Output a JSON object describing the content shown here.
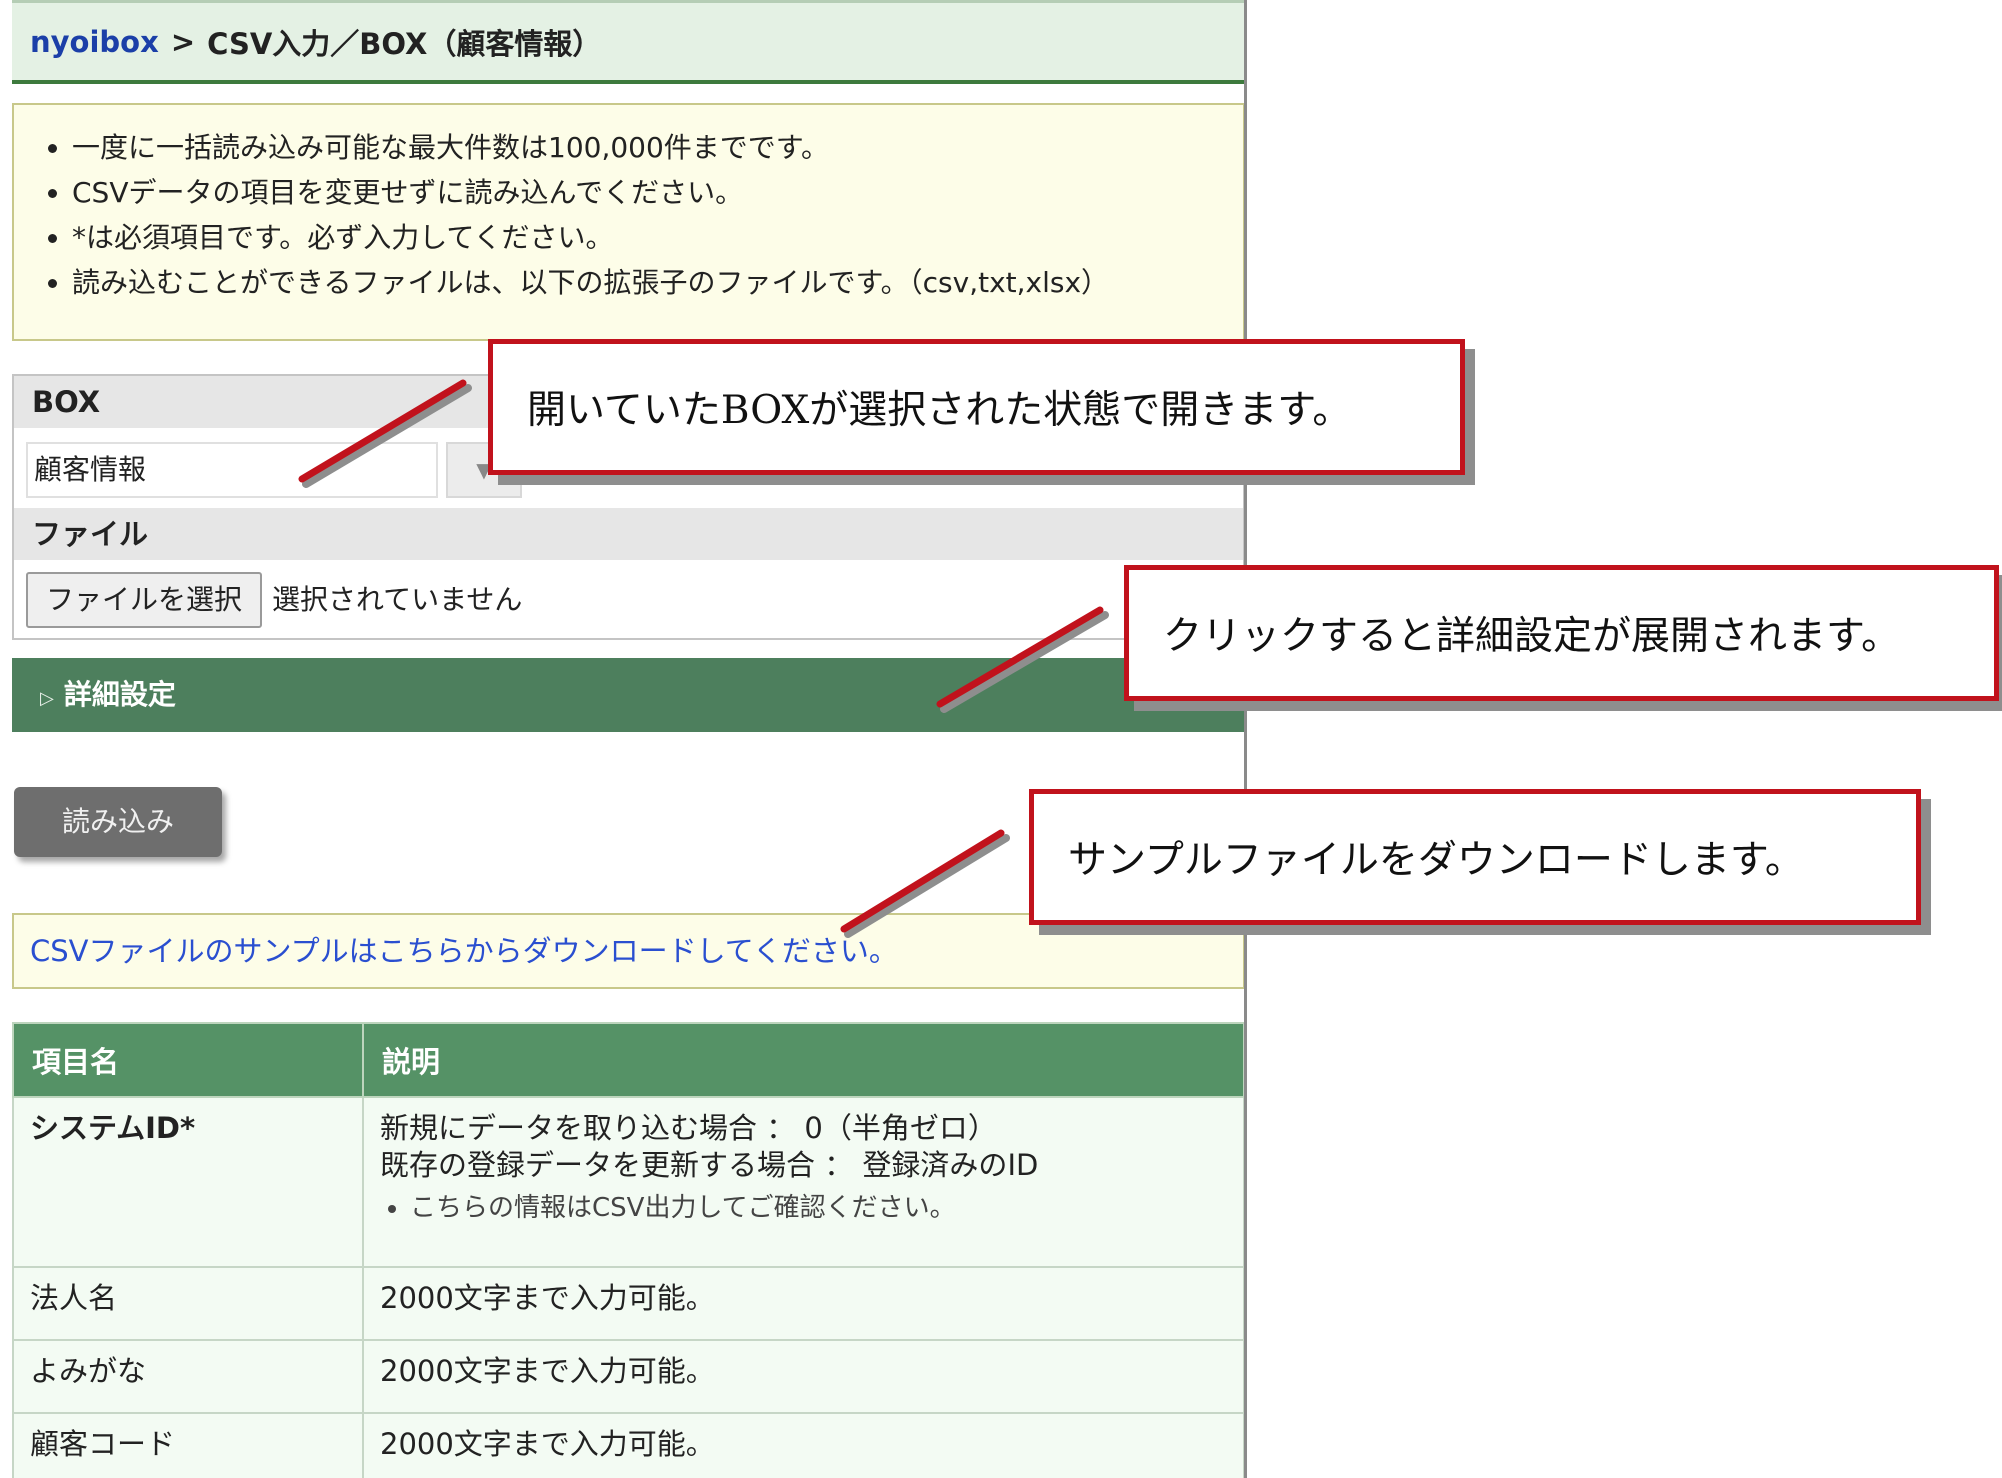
{
  "breadcrumb": {
    "root": "nyoibox",
    "separator": ">",
    "current": "CSV入力／BOX（顧客情報）"
  },
  "notice": {
    "items": [
      "一度に一括読み込み可能な最大件数は100,000件までです。",
      "CSVデータの項目を変更せずに読み込んでください。",
      "*は必須項目です。必ず入力してください。",
      "読み込むことができるファイルは、以下の拡張子のファイルです。（csv,txt,xlsx）"
    ]
  },
  "form": {
    "box_label": "BOX",
    "box_value": "顧客情報",
    "file_label": "ファイル",
    "file_button": "ファイルを選択",
    "file_status": "選択されていません"
  },
  "advanced": {
    "label": "詳細設定"
  },
  "load_button": "読み込み",
  "sample_link": "CSVファイルのサンプルはこちらからダウンロードしてください。",
  "table": {
    "headers": [
      "項目名",
      "説明"
    ],
    "rows": [
      {
        "name": "システムID*",
        "line1": "新規にデータを取り込む場合 ： 0（半角ゼロ）",
        "line2": "既存の登録データを更新する場合 ： 登録済みのID",
        "bullet": "こちらの情報はCSV出力してご確認ください。"
      },
      {
        "name": "法人名",
        "desc": "2000文字まで入力可能。"
      },
      {
        "name": "よみがな",
        "desc": "2000文字まで入力可能。"
      },
      {
        "name": "顧客コード",
        "desc": "2000文字まで入力可能。"
      }
    ]
  },
  "callouts": {
    "box": "開いていたBOXが選択された状態で開きます。",
    "advanced": "クリックすると詳細設定が展開されます。",
    "sample": "サンプルファイルをダウンロードします。"
  },
  "colors": {
    "callout_border": "#c1121c",
    "header_green": "#559266",
    "advanced_green": "#4d7f5d",
    "link_blue": "#2a4fd0"
  }
}
